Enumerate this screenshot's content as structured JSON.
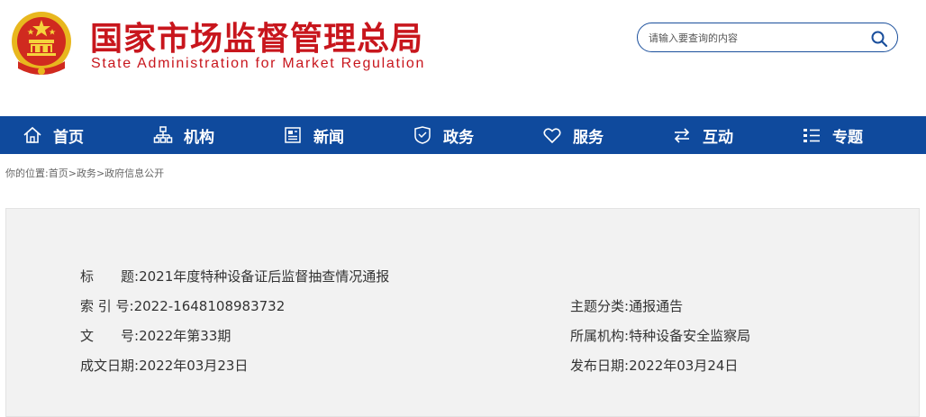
{
  "header": {
    "title_zh": "国家市场监督管理总局",
    "title_en": "State Administration for Market Regulation",
    "emblem_icon": "national-emblem-icon",
    "brand_color": "#c8161d"
  },
  "search": {
    "placeholder": "请输入要查询的内容",
    "icon": "search-icon"
  },
  "nav": {
    "background": "#0f4a9d",
    "items": [
      {
        "label": "首页",
        "icon": "home-icon"
      },
      {
        "label": "机构",
        "icon": "org-chart-icon"
      },
      {
        "label": "新闻",
        "icon": "newspaper-icon"
      },
      {
        "label": "政务",
        "icon": "government-icon"
      },
      {
        "label": "服务",
        "icon": "heart-icon"
      },
      {
        "label": "互动",
        "icon": "exchange-arrows-icon"
      },
      {
        "label": "专题",
        "icon": "list-icon"
      }
    ]
  },
  "breadcrumb": {
    "prefix": "你的位置:",
    "items": [
      "首页",
      "政务",
      "政府信息公开"
    ],
    "separator": ">"
  },
  "info": {
    "title_label": "标　　题:",
    "title_value": "2021年度特种设备证后监督抽查情况通报",
    "index_label": "索 引 号:",
    "index_value": "2022-1648108983732",
    "doc_no_label": "文　　号:",
    "doc_no_value": "2022年第33期",
    "created_label": "成文日期:",
    "created_value": "2022年03月23日",
    "category_label": "主题分类:",
    "category_value": "通报通告",
    "org_label": "所属机构:",
    "org_value": "特种设备安全监察局",
    "published_label": "发布日期:",
    "published_value": "2022年03月24日"
  }
}
